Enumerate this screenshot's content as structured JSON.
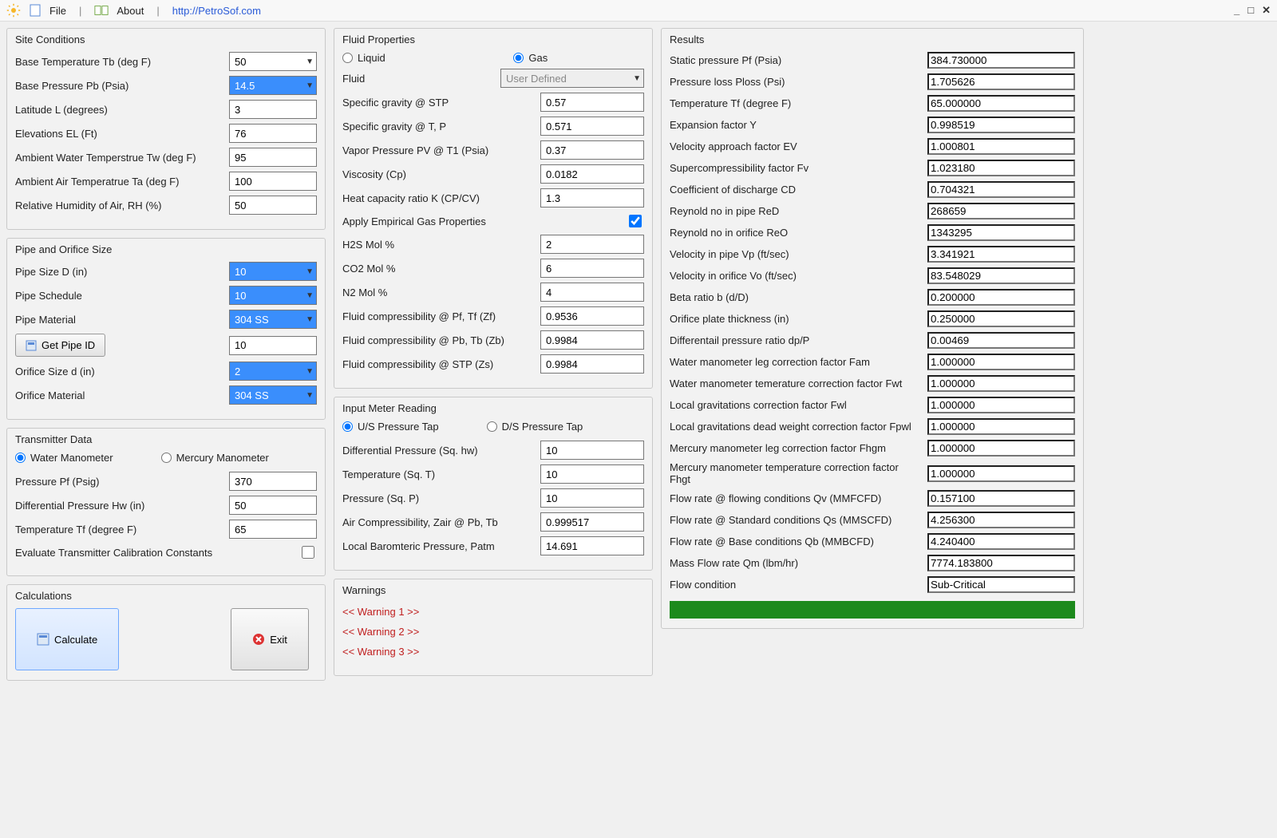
{
  "menu": {
    "file": "File",
    "about": "About",
    "link": "http://PetroSof.com"
  },
  "groups": {
    "site": "Site Conditions",
    "pipe": "Pipe and Orifice Size",
    "trans": "Transmitter Data",
    "calc": "Calculations",
    "fluid": "Fluid Properties",
    "meter": "Input Meter Reading",
    "warn": "Warnings",
    "results": "Results"
  },
  "site": {
    "tb_label": "Base Temperature Tb (deg F)",
    "tb": "50",
    "pb_label": "Base Pressure Pb (Psia)",
    "pb": "14.5",
    "lat_label": "Latitude L (degrees)",
    "lat": "3",
    "el_label": "Elevations EL (Ft)",
    "el": "76",
    "tw_label": "Ambient Water Temperstrue Tw (deg F)",
    "tw": "95",
    "ta_label": "Ambient Air Temperatrue Ta (deg F)",
    "ta": "100",
    "rh_label": "Relative Humidity of Air, RH (%)",
    "rh": "50"
  },
  "pipe": {
    "d_label": "Pipe Size D (in)",
    "d": "10",
    "sched_label": "Pipe Schedule",
    "sched": "10",
    "mat_label": "Pipe Material",
    "mat": "304 SS",
    "get_id_btn": "Get Pipe ID",
    "id": "10",
    "od_label": "Orifice Size d (in)",
    "od": "2",
    "omat_label": "Orifice Material",
    "omat": "304 SS"
  },
  "trans": {
    "water_label": "Water Manometer",
    "mercury_label": "Mercury Manometer",
    "pf_label": "Pressure Pf (Psig)",
    "pf": "370",
    "hw_label": "Differential Pressure Hw (in)",
    "hw": "50",
    "tf_label": "Temperature Tf (degree F)",
    "tf": "65",
    "eval_label": "Evaluate Transmitter Calibration Constants"
  },
  "buttons": {
    "calculate": "Calculate",
    "exit": "Exit"
  },
  "fluid": {
    "liquid": "Liquid",
    "gas": "Gas",
    "fluid_label": "Fluid",
    "fluid_sel": "User Defined",
    "sg_stp_label": "Specific gravity @ STP",
    "sg_stp": "0.57",
    "sg_tp_label": "Specific gravity @ T, P",
    "sg_tp": "0.571",
    "pv_label": "Vapor Pressure PV @ T1 (Psia)",
    "pv": "0.37",
    "visc_label": "Viscosity (Cp)",
    "visc": "0.0182",
    "k_label": "Heat capacity ratio K (CP/CV)",
    "k": "1.3",
    "apply_label": "Apply Empirical Gas Properties",
    "h2s_label": "H2S Mol %",
    "h2s": "2",
    "co2_label": "CO2 Mol %",
    "co2": "6",
    "n2_label": "N2 Mol %",
    "n2": "4",
    "zf_label": "Fluid compressibility @ Pf, Tf (Zf)",
    "zf": "0.9536",
    "zb_label": "Fluid compressibility @ Pb, Tb (Zb)",
    "zb": "0.9984",
    "zs_label": "Fluid compressibility @ STP (Zs)",
    "zs": "0.9984"
  },
  "meter": {
    "us_label": "U/S Pressure Tap",
    "ds_label": "D/S Pressure Tap",
    "dp_label": "Differential Pressure (Sq. hw)",
    "dp": "10",
    "t_label": "Temperature (Sq. T)",
    "t": "10",
    "p_label": "Pressure (Sq. P)",
    "p": "10",
    "zair_label": "Air Compressibility, Zair @ Pb, Tb",
    "zair": "0.999517",
    "patm_label": "Local Baromteric Pressure, Patm",
    "patm": "14.691"
  },
  "warnings": {
    "w1": "<< Warning 1 >>",
    "w2": "<< Warning 2 >>",
    "w3": "<< Warning 3 >>"
  },
  "results": {
    "pf_label": "Static pressure Pf (Psia)",
    "pf": "384.730000",
    "ploss_label": "Pressure loss Ploss (Psi)",
    "ploss": "1.705626",
    "tf_label": "Temperature Tf (degree F)",
    "tf": "65.000000",
    "y_label": "Expansion factor Y",
    "y": "0.998519",
    "ev_label": "Velocity approach factor EV",
    "ev": "1.000801",
    "fv_label": "Supercompressibility factor Fv",
    "fv": "1.023180",
    "cd_label": "Coefficient of discharge CD",
    "cd": "0.704321",
    "red_label": "Reynold no in pipe ReD",
    "red": "268659",
    "reo_label": "Reynold no in orifice ReO",
    "reo": "1343295",
    "vp_label": "Velocity in pipe Vp (ft/sec)",
    "vp": "3.341921",
    "vo_label": "Velocity in orifice Vo (ft/sec)",
    "vo": "83.548029",
    "beta_label": "Beta ratio b (d/D)",
    "beta": "0.200000",
    "thk_label": "Orifice plate thickness (in)",
    "thk": "0.250000",
    "dpp_label": "Differentail pressure ratio dp/P",
    "dpp": "0.00469",
    "fam_label": "Water manometer leg correction factor Fam",
    "fam": "1.000000",
    "fwt_label": "Water manometer temerature correction factor Fwt",
    "fwt": "1.000000",
    "fwl_label": "Local gravitations correction factor Fwl",
    "fwl": "1.000000",
    "fpwl_label": "Local gravitations dead weight correction factor Fpwl",
    "fpwl": "1.000000",
    "fhgm_label": "Mercury manometer leg correction factor Fhgm",
    "fhgm": "1.000000",
    "fhgt_label": "Mercury manometer temperature correction factor Fhgt",
    "fhgt": "1.000000",
    "qv_label": "Flow rate @ flowing conditions Qv (MMFCFD)",
    "qv": "0.157100",
    "qs_label": "Flow rate @ Standard conditions Qs (MMSCFD)",
    "qs": "4.256300",
    "qb_label": "Flow rate @ Base conditions Qb (MMBCFD)",
    "qb": "4.240400",
    "qm_label": "Mass Flow rate Qm (lbm/hr)",
    "qm": "7774.183800",
    "cond_label": "Flow condition",
    "cond": "Sub-Critical"
  }
}
